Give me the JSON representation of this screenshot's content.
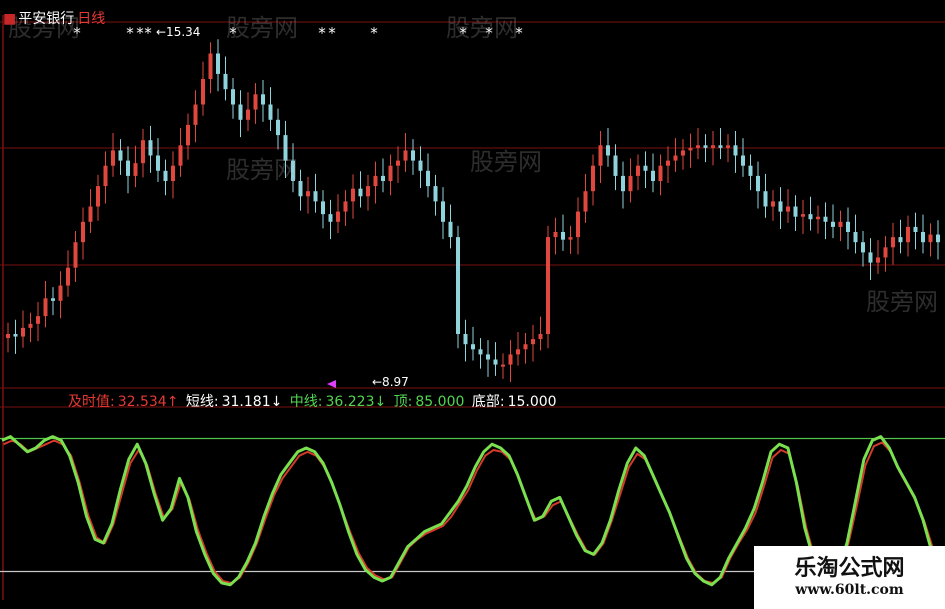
{
  "header": {
    "symbol": "平安银行",
    "period": "日线"
  },
  "price_panel": {
    "max_label": "←15.34",
    "min_label": "←8.97",
    "signal_marker": "*"
  },
  "indicator": {
    "label_main": "及时值:",
    "value_main": "32.534↑",
    "label_short": "短线:",
    "value_short": "31.181↓",
    "label_mid": "中线:",
    "value_mid": "36.223↓",
    "label_top": "顶:",
    "value_top": "85.000",
    "label_bottom": "底部:",
    "value_bottom": "15.000"
  },
  "watermarks": [
    "股旁网",
    "股旁网",
    "股旁网",
    "股旁网",
    "股旁网",
    "股旁网"
  ],
  "logo": {
    "title": "乐淘公式网",
    "url": "www.60lt.com"
  },
  "colors": {
    "up": "#e0473f",
    "down": "#8fd3dc",
    "line_green": "#7be04f",
    "line_red": "#d43a2a",
    "level": "#52c24a",
    "grid": "#7a1010"
  },
  "chart_data": [
    {
      "type": "candlestick",
      "title": "平安银行 日线",
      "ylim": [
        8.6,
        15.6
      ],
      "max_price": 15.34,
      "min_price": 8.97,
      "close": [
        9.6,
        9.55,
        9.72,
        9.8,
        9.95,
        10.3,
        10.25,
        10.55,
        10.9,
        11.4,
        11.8,
        12.1,
        12.5,
        12.9,
        13.2,
        13.0,
        12.7,
        12.95,
        13.4,
        13.1,
        12.8,
        12.6,
        12.9,
        13.3,
        13.7,
        14.1,
        14.6,
        15.1,
        14.7,
        14.4,
        14.1,
        13.8,
        14.0,
        14.3,
        14.1,
        13.8,
        13.5,
        13.0,
        12.6,
        12.3,
        12.4,
        12.2,
        11.95,
        11.8,
        12.0,
        12.2,
        12.45,
        12.3,
        12.5,
        12.7,
        12.6,
        12.9,
        13.0,
        13.2,
        13.0,
        12.8,
        12.5,
        12.2,
        11.8,
        11.5,
        9.6,
        9.4,
        9.3,
        9.2,
        9.1,
        9.0,
        9.0,
        9.2,
        9.3,
        9.4,
        9.5,
        9.6,
        11.5,
        11.6,
        11.45,
        11.5,
        12.0,
        12.4,
        12.9,
        13.3,
        13.1,
        12.7,
        12.4,
        12.7,
        12.9,
        12.8,
        12.6,
        12.9,
        13.0,
        13.1,
        13.2,
        13.25,
        13.3,
        13.25,
        13.3,
        13.25,
        13.3,
        13.1,
        12.9,
        12.7,
        12.4,
        12.1,
        12.2,
        12.0,
        12.1,
        11.9,
        11.95,
        11.85,
        11.9,
        11.8,
        11.7,
        11.8,
        11.6,
        11.4,
        11.2,
        11.0,
        11.1,
        11.3,
        11.5,
        11.4,
        11.7,
        11.6,
        11.4,
        11.55,
        11.4
      ]
    },
    {
      "type": "line",
      "title": "",
      "ylim": [
        0,
        100
      ],
      "levels": [
        85,
        15
      ],
      "series": [
        {
          "values": [
            84,
            86,
            82,
            78,
            80,
            84,
            86,
            84,
            76,
            62,
            44,
            32,
            30,
            40,
            58,
            74,
            82,
            72,
            56,
            42,
            48,
            64,
            54,
            36,
            24,
            14,
            9,
            8,
            12,
            20,
            30,
            44,
            56,
            66,
            72,
            78,
            80,
            78,
            72,
            62,
            50,
            36,
            24,
            16,
            12,
            10,
            12,
            20,
            28,
            32,
            36,
            38,
            40,
            46,
            52,
            60,
            70,
            78,
            82,
            80,
            76,
            66,
            54,
            42,
            44,
            52,
            54,
            44,
            34,
            26,
            24,
            30,
            42,
            58,
            72,
            80,
            76,
            66,
            56,
            46,
            34,
            22,
            14,
            10,
            8,
            12,
            22,
            30,
            38,
            48,
            62,
            78,
            82,
            80,
            62,
            38,
            22,
            12,
            8,
            16,
            30,
            52,
            74,
            84,
            86,
            80,
            70,
            62,
            54,
            42,
            26,
            18
          ]
        },
        {
          "values": [
            83,
            85,
            83,
            79,
            81,
            83,
            85,
            83,
            77,
            63,
            46,
            34,
            31,
            41,
            57,
            73,
            80,
            72,
            57,
            44,
            49,
            63,
            54,
            38,
            26,
            16,
            11,
            10,
            13,
            21,
            31,
            44,
            56,
            65,
            71,
            77,
            79,
            77,
            71,
            61,
            49,
            37,
            26,
            18,
            14,
            12,
            13,
            21,
            29,
            33,
            36,
            38,
            40,
            45,
            52,
            59,
            69,
            77,
            80,
            79,
            75,
            65,
            53,
            43,
            45,
            51,
            53,
            44,
            35,
            27,
            25,
            31,
            43,
            57,
            71,
            78,
            75,
            65,
            55,
            45,
            34,
            23,
            15,
            11,
            10,
            13,
            23,
            31,
            38,
            47,
            61,
            76,
            80,
            78,
            61,
            39,
            23,
            14,
            10,
            17,
            31,
            51,
            72,
            82,
            84,
            79,
            69,
            61,
            53,
            42,
            28,
            20
          ]
        }
      ]
    }
  ]
}
